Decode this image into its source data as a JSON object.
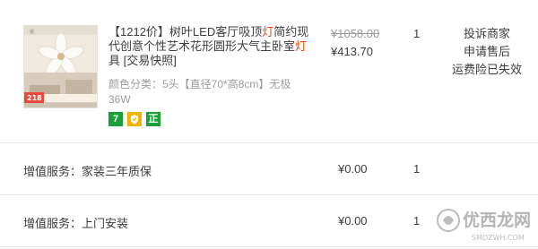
{
  "order_item": {
    "title_parts": [
      "【1212价】树叶LED客厅吸顶",
      "灯",
      "简约现代创意个性艺术花形圆形大气主卧室",
      "灯",
      "具 [交易快照]"
    ],
    "sku_text": "颜色分类：5头【直径70*高8cm】无极36W",
    "original_price": "¥1058.00",
    "current_price": "¥413.70",
    "quantity": "1",
    "actions": [
      "投诉商家",
      "申请售后",
      "运费险已失效"
    ],
    "badges": [
      {
        "text": "7",
        "color": "#1aa038"
      },
      {
        "text": "",
        "icon": "shield-icon",
        "color": "#f0b400"
      },
      {
        "text": "正",
        "color": "#1aa038"
      }
    ],
    "thumbnail_banner": "218"
  },
  "services": [
    {
      "label": "增值服务：家装三年质保",
      "price": "¥0.00",
      "quantity": "1"
    },
    {
      "label": "增值服务：上门安装",
      "price": "¥0.00",
      "quantity": "1"
    }
  ],
  "watermark": {
    "main": "优西龙网",
    "sub": "SMDZWH.COM"
  }
}
